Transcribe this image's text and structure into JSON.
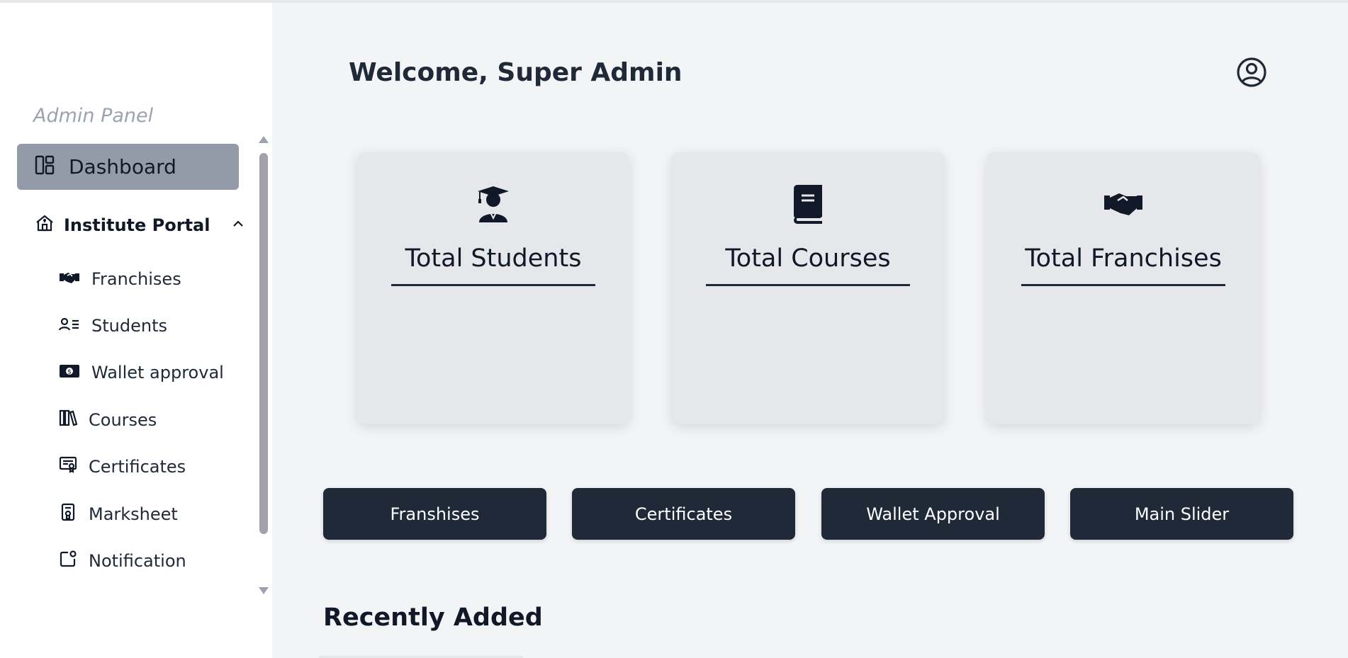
{
  "sidebar": {
    "panel_title": "Admin Panel",
    "dashboard_label": "Dashboard",
    "portal_label": "Institute Portal",
    "items": [
      {
        "label": "Franchises",
        "icon": "handshake-icon"
      },
      {
        "label": "Students",
        "icon": "user-list-icon"
      },
      {
        "label": "Wallet approval",
        "icon": "money-icon"
      },
      {
        "label": "Courses",
        "icon": "books-icon"
      },
      {
        "label": "Certificates",
        "icon": "certificate-icon"
      },
      {
        "label": "Marksheet",
        "icon": "marksheet-icon"
      },
      {
        "label": "Notification",
        "icon": "notification-icon"
      }
    ]
  },
  "header": {
    "welcome": "Welcome, Super Admin",
    "user_icon": "user-circle-icon"
  },
  "cards": [
    {
      "title": "Total Students",
      "icon": "graduate-icon"
    },
    {
      "title": "Total Courses",
      "icon": "book-icon"
    },
    {
      "title": "Total Franchises",
      "icon": "handshake-icon"
    }
  ],
  "quick_buttons": [
    "Franshises",
    "Certificates",
    "Wallet Approval",
    "Main Slider"
  ],
  "recent": {
    "title": "Recently Added"
  },
  "colors": {
    "accent": "#1f2937",
    "active": "#949ba8",
    "background": "#f3f4f6"
  }
}
